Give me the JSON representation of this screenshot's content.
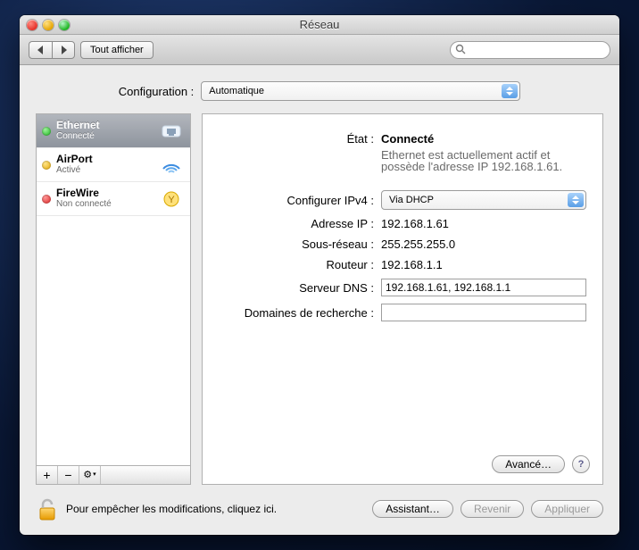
{
  "window": {
    "title": "Réseau"
  },
  "toolbar": {
    "show_all": "Tout afficher",
    "search_placeholder": ""
  },
  "config": {
    "label": "Configuration :",
    "value": "Automatique"
  },
  "sidebar": {
    "items": [
      {
        "name": "Ethernet",
        "status": "Connecté",
        "dot": "sd-green",
        "icon": "ethernet",
        "selected": true
      },
      {
        "name": "AirPort",
        "status": "Activé",
        "dot": "sd-yellow",
        "icon": "airport",
        "selected": false
      },
      {
        "name": "FireWire",
        "status": "Non connecté",
        "dot": "sd-red",
        "icon": "firewire",
        "selected": false
      }
    ],
    "add": "+",
    "remove": "−",
    "gear": "⚙"
  },
  "detail": {
    "state_label": "État :",
    "state_value": "Connecté",
    "state_desc": "Ethernet est actuellement actif et possède l'adresse IP 192.168.1.61.",
    "ipv4_label": "Configurer IPv4 :",
    "ipv4_value": "Via DHCP",
    "ip_label": "Adresse IP :",
    "ip_value": "192.168.1.61",
    "mask_label": "Sous-réseau :",
    "mask_value": "255.255.255.0",
    "router_label": "Routeur :",
    "router_value": "192.168.1.1",
    "dns_label": "Serveur DNS :",
    "dns_value": "192.168.1.61, 192.168.1.1",
    "search_label": "Domaines de recherche :",
    "search_value": "",
    "advanced": "Avancé…",
    "help": "?"
  },
  "footer": {
    "lock_text": "Pour empêcher les modifications, cliquez ici.",
    "assistant": "Assistant…",
    "revert": "Revenir",
    "apply": "Appliquer"
  }
}
